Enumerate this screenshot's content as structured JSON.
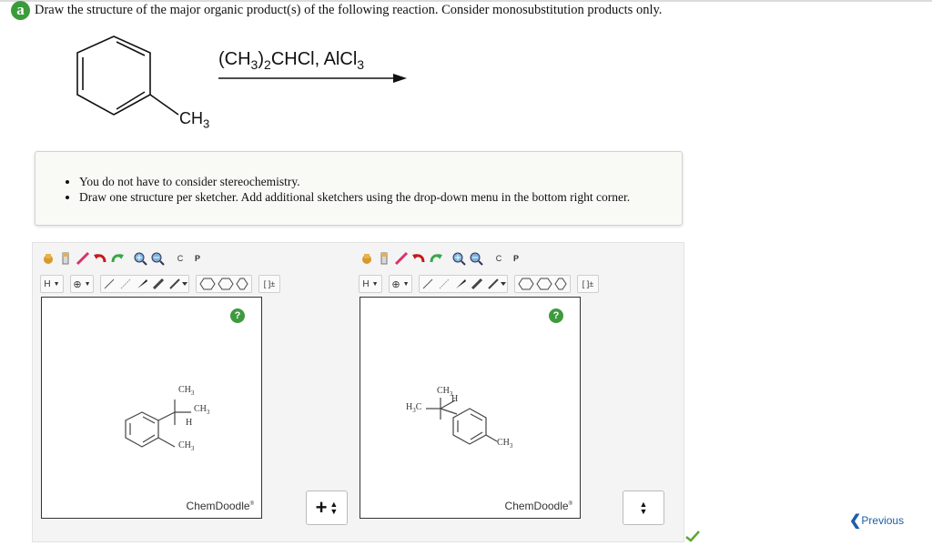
{
  "question": {
    "badge": "a",
    "text": "Draw the structure of the major organic product(s) of the following reaction. Consider monosubstitution products only."
  },
  "reaction": {
    "reagent_parts": [
      "(CH",
      "3",
      ")",
      "2",
      "CHCl, AlCl",
      "3"
    ],
    "substituent_parts": [
      "CH",
      "3"
    ]
  },
  "instructions": [
    "You do not have to consider stereochemistry.",
    "Draw one structure per sketcher. Add additional sketchers using the drop-down menu in the bottom right corner."
  ],
  "toolbar": {
    "row1_icons": [
      "hand-icon",
      "eraser-tall-icon",
      "pencil-icon",
      "undo-icon",
      "redo-icon",
      "zoom-in-icon",
      "zoom-out-icon",
      "clean-icon",
      "paste-icon"
    ],
    "clean_label": "C",
    "paste_label": "P",
    "element_label": "H",
    "charge_label": "⊕",
    "brackets_label": "[ ]±"
  },
  "sketchers": [
    {
      "help_label": "?",
      "brand": "ChemDoodle",
      "brand_mark": "®",
      "labels": [
        "CH",
        "3",
        "CH",
        "3",
        "H",
        "CH",
        "3"
      ]
    },
    {
      "help_label": "?",
      "brand": "ChemDoodle",
      "brand_mark": "®",
      "labels": [
        "CH",
        "3",
        "H",
        "H",
        "3",
        "C",
        "CH",
        "3"
      ]
    }
  ],
  "add_controls": {
    "plus_label": "+",
    "updown_label": "▲▼"
  },
  "navigation": {
    "previous_label": "Previous"
  },
  "colors": {
    "badge": "#3b9b3b",
    "help": "#3f9a3f",
    "check": "#5aa832",
    "link": "#1b5fa8"
  }
}
